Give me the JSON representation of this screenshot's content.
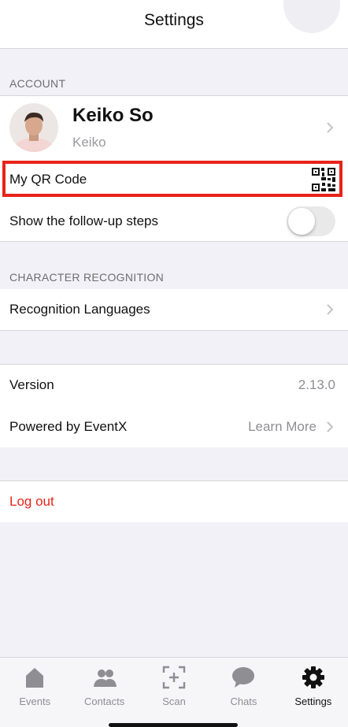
{
  "header": {
    "title": "Settings"
  },
  "account": {
    "section_label": "ACCOUNT",
    "profile": {
      "name": "Keiko So",
      "username": "Keiko"
    },
    "qr_label": "My QR Code",
    "followup_label": "Show the follow-up steps",
    "followup_enabled": false
  },
  "recognition": {
    "section_label": "CHARACTER RECOGNITION",
    "languages_label": "Recognition Languages"
  },
  "about": {
    "version_label": "Version",
    "version_value": "2.13.0",
    "powered_label": "Powered by EventX",
    "powered_value": "Learn More"
  },
  "logout_label": "Log out",
  "colors": {
    "danger": "#e8231a",
    "toggle_off": "#e9e9ea",
    "active_tab": "#111111"
  },
  "tabs": [
    {
      "label": "Events",
      "icon": "home-icon"
    },
    {
      "label": "Contacts",
      "icon": "contacts-icon"
    },
    {
      "label": "Scan",
      "icon": "scan-icon"
    },
    {
      "label": "Chats",
      "icon": "chat-icon"
    },
    {
      "label": "Settings",
      "icon": "gear-icon",
      "active": true
    }
  ]
}
